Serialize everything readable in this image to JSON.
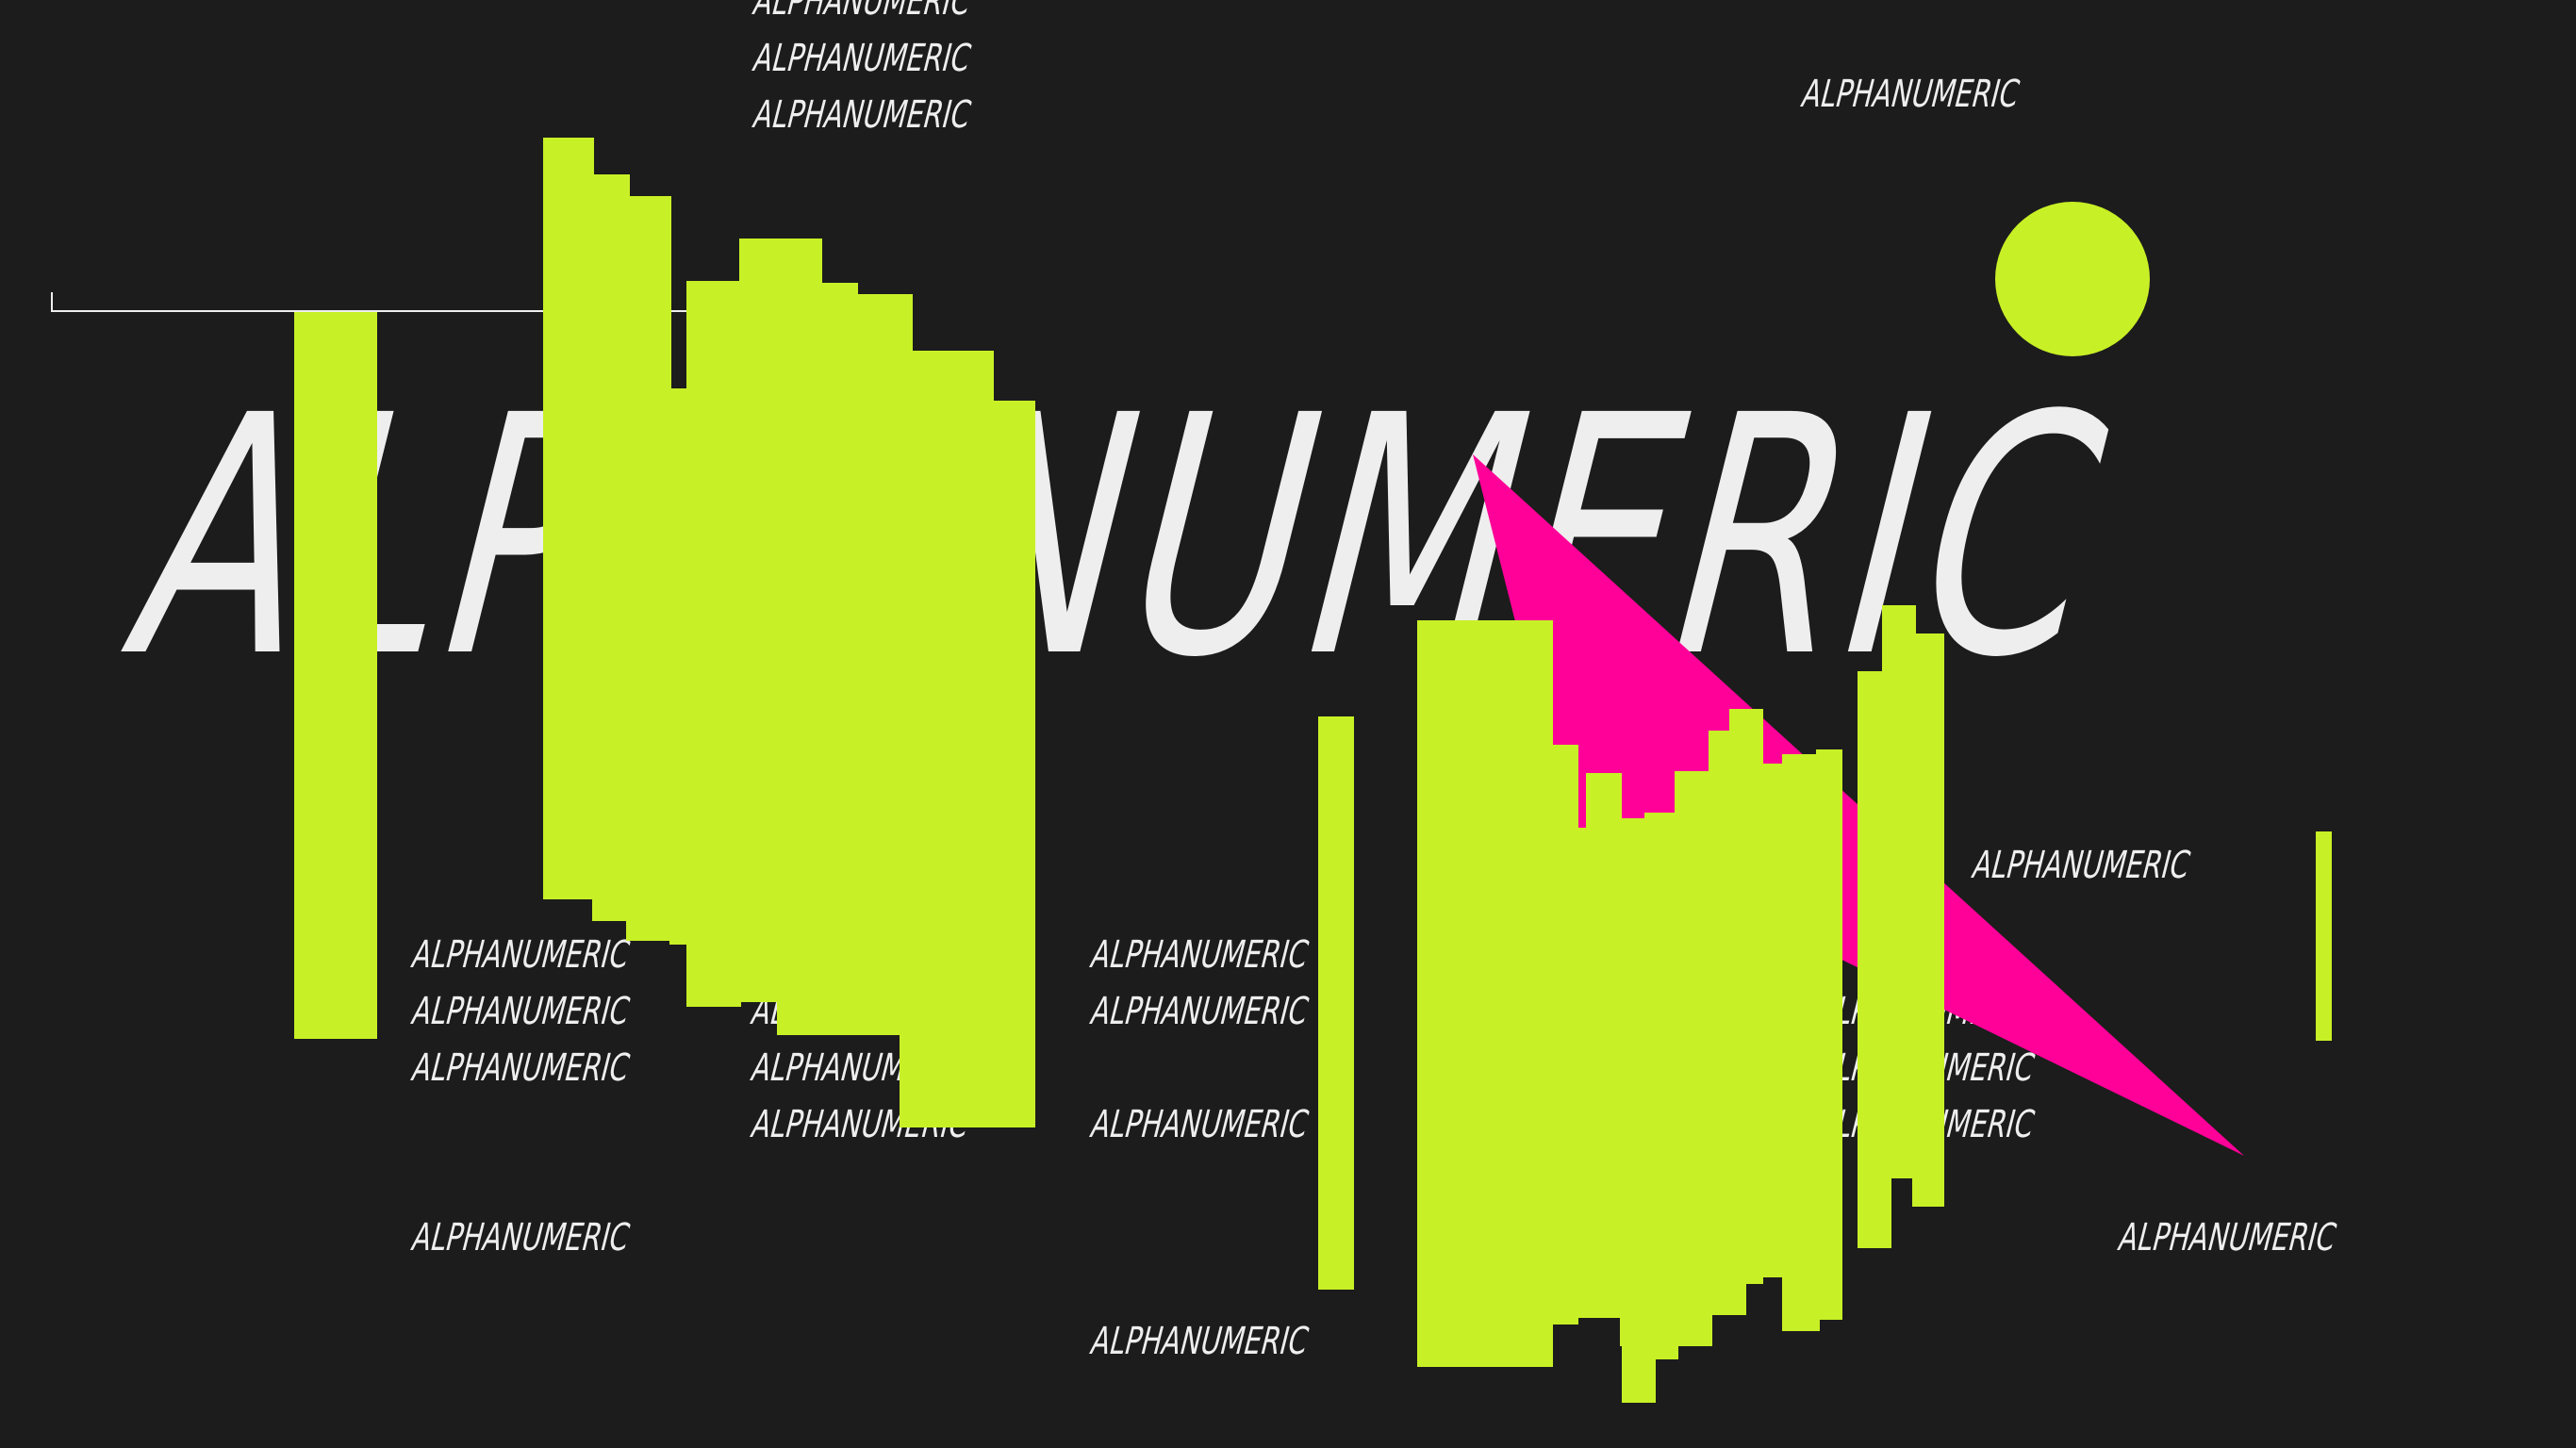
{
  "headline": "ALPHANUMERIC",
  "small_text": "ALPHANUMERIC",
  "colors": {
    "background": "#1c1c1c",
    "text": "#eeeeee",
    "lime": "#c8f026",
    "magenta": "#ff0099"
  }
}
